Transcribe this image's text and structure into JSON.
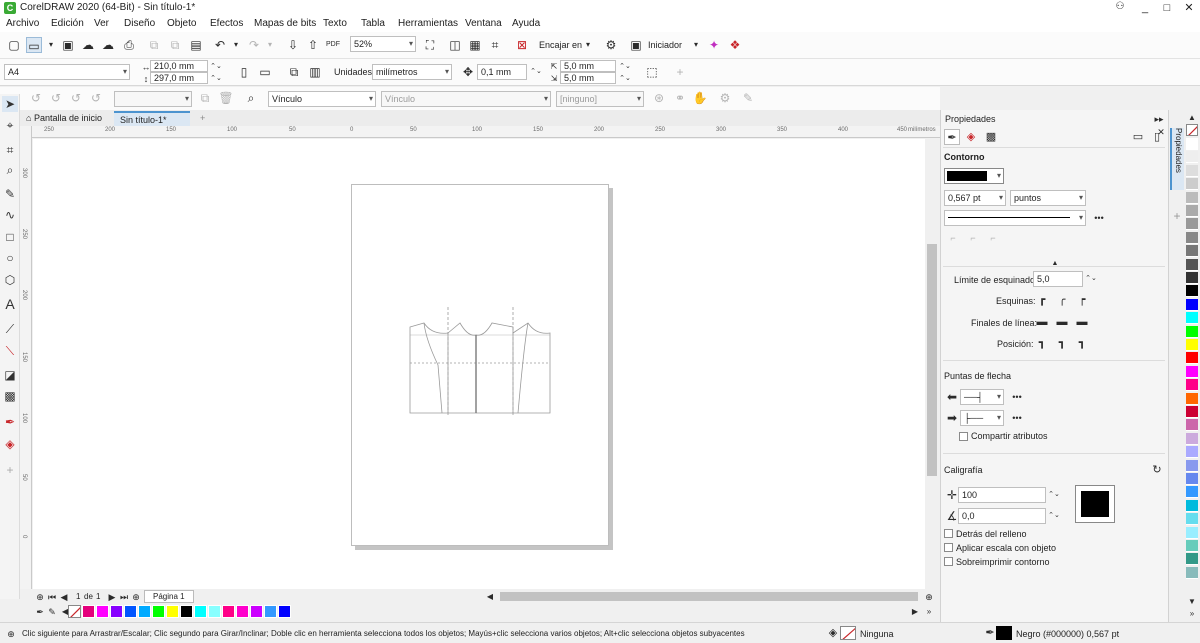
{
  "window": {
    "title": "CorelDRAW 2020 (64-Bit) - Sin título-1*",
    "controls": [
      "_",
      "□",
      "✕"
    ]
  },
  "menu": [
    "Archivo",
    "Edición",
    "Ver",
    "Diseño",
    "Objeto",
    "Efectos",
    "Mapas de bits",
    "Texto",
    "Tabla",
    "Herramientas",
    "Ventana",
    "Ayuda"
  ],
  "toolbar1": {
    "zoom": "52%",
    "snap_label": "Encajar en",
    "launcher_label": "Iniciador"
  },
  "toolbar2": {
    "page_size": "A4",
    "width": "210,0 mm",
    "height": "297,0 mm",
    "units_label": "Unidades:",
    "units": "milímetros",
    "nudge": "0,1 mm",
    "dup_x": "5,0 mm",
    "dup_y": "5,0 mm"
  },
  "toolbar3": {
    "link_type": "Vínculo",
    "link_url": "Vínculo",
    "target": "[ninguno]"
  },
  "tabs": {
    "home": "Pantalla de inicio",
    "doc": "Sin título-1*"
  },
  "ruler": {
    "top": [
      "250",
      "200",
      "150",
      "100",
      "50",
      "0",
      "50",
      "100",
      "150",
      "200",
      "250",
      "300",
      "350",
      "400",
      "450"
    ],
    "unit": "milímetros",
    "left": [
      "300",
      "250",
      "200",
      "150",
      "100",
      "50",
      "0"
    ]
  },
  "pagenav": {
    "page_of": "1",
    "de": "de",
    "total": "1",
    "page_tab": "Página 1"
  },
  "doc_palette": [
    "#e4007c",
    "#ff00ff",
    "#8800ff",
    "#0055ff",
    "#00aaff",
    "#00ff00",
    "#ffff00",
    "#000000",
    "#00ffff",
    "#88ffff",
    "#ff0088",
    "#ff00cc",
    "#cc00ff",
    "#3399ff",
    "#0000ff"
  ],
  "status": {
    "hint": "Clic siguiente para Arrastrar/Escalar; Clic segundo para Girar/Inclinar; Doble clic en herramienta selecciona todos los objetos; Mayús+clic selecciona varios objetos; Alt+clic selecciona objetos subyacentes",
    "fill": "Ninguna",
    "outline": "Negro (#000000)  0,567 pt"
  },
  "props": {
    "title": "Propiedades",
    "section_contorno": "Contorno",
    "outline_width": "0,567 pt",
    "outline_units": "puntos",
    "miter_label": "Límite de esquinado:",
    "miter_value": "5,0",
    "corners_label": "Esquinas:",
    "caps_label": "Finales de línea:",
    "position_label": "Posición:",
    "arrows_label": "Puntas de flecha",
    "share_attrs": "Compartir atributos",
    "caligrafia": "Caligrafía",
    "stretch": "100",
    "angle": "0,0",
    "behind_fill": "Detrás del relleno",
    "scale_with": "Aplicar escala con objeto",
    "overprint": "Sobreimprimir contorno",
    "side_tab": "Propiedades"
  },
  "palette": [
    "#ffffff",
    "#eeeeee",
    "#dddddd",
    "#cccccc",
    "#bbbbbb",
    "#aaaaaa",
    "#999999",
    "#888888",
    "#777777",
    "#555555",
    "#333333",
    "#000000",
    "#0000ff",
    "#00ffff",
    "#00ff00",
    "#ffff00",
    "#ff0000",
    "#ff00ff",
    "#ff0088",
    "#ff6600",
    "#cc0033",
    "#cc66aa",
    "#ccaadd",
    "#aaaaff",
    "#8899ee",
    "#6688ee",
    "#3399ff",
    "#00bbdd",
    "#66ddee",
    "#99eeff",
    "#66ccbb",
    "#339988",
    "#88bbbb"
  ]
}
